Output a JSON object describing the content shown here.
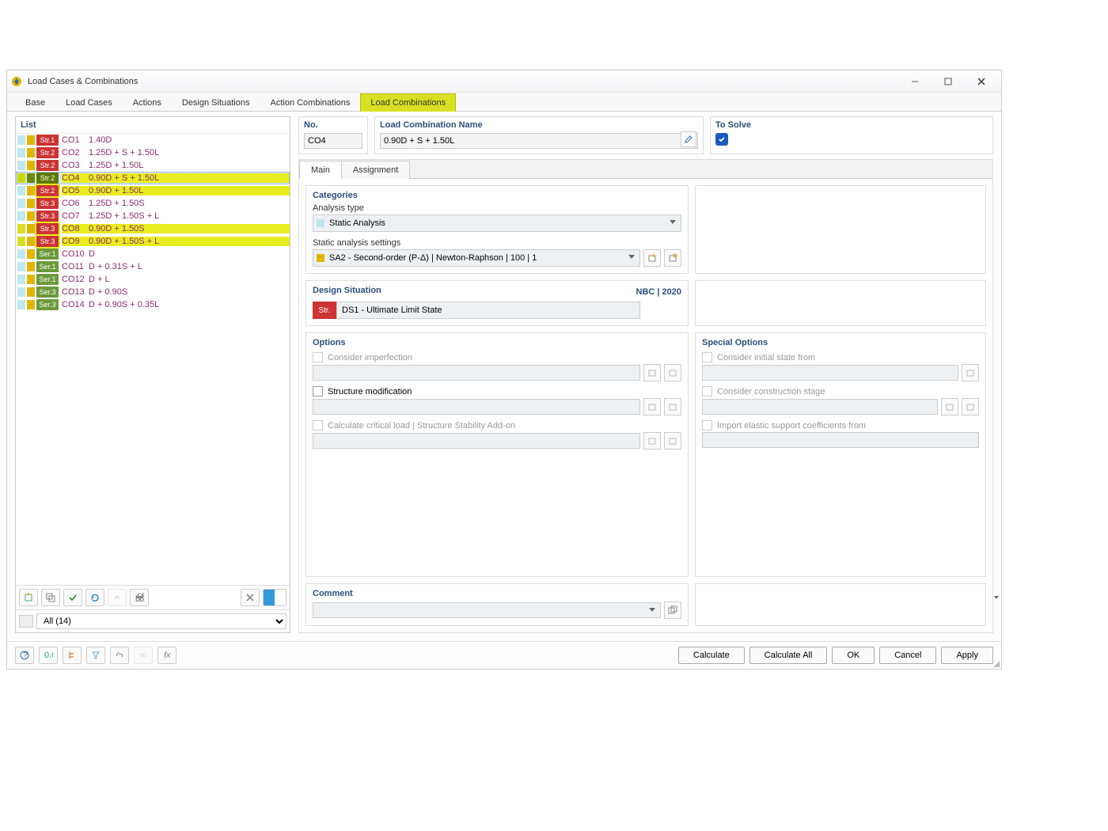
{
  "window": {
    "title": "Load Cases & Combinations"
  },
  "tabs": [
    "Base",
    "Load Cases",
    "Actions",
    "Design Situations",
    "Action Combinations",
    "Load Combinations"
  ],
  "activeTab": 5,
  "list": {
    "header": "List",
    "items": [
      {
        "sw1": "#bfe8f0",
        "sw2": "#e2b600",
        "badge": "Str.1",
        "badgeBg": "#c33",
        "co": "CO1",
        "desc": "1.40D",
        "selected": false,
        "hl": false
      },
      {
        "sw1": "#bfe8f0",
        "sw2": "#e2b600",
        "badge": "Str.2",
        "badgeBg": "#c33",
        "co": "CO2",
        "desc": "1.25D + S + 1.50L",
        "selected": false,
        "hl": false
      },
      {
        "sw1": "#bfe8f0",
        "sw2": "#e2b600",
        "badge": "Str.2",
        "badgeBg": "#c33",
        "co": "CO3",
        "desc": "1.25D + 1.50L",
        "selected": false,
        "hl": false
      },
      {
        "sw1": "#c7d900",
        "sw2": "#6a8a00",
        "badge": "Str.2",
        "badgeBg": "#5d7a00",
        "co": "CO4",
        "desc": "0.90D + S + 1.50L",
        "selected": true,
        "hl": true
      },
      {
        "sw1": "#bfe8f0",
        "sw2": "#e2b600",
        "badge": "Str.2",
        "badgeBg": "#c33",
        "co": "CO5",
        "desc": "0.90D + 1.50L",
        "selected": false,
        "hl": true
      },
      {
        "sw1": "#bfe8f0",
        "sw2": "#e2b600",
        "badge": "Str.3",
        "badgeBg": "#c33",
        "co": "CO6",
        "desc": "1.25D + 1.50S",
        "selected": false,
        "hl": false
      },
      {
        "sw1": "#bfe8f0",
        "sw2": "#e2b600",
        "badge": "Str.3",
        "badgeBg": "#c33",
        "co": "CO7",
        "desc": "1.25D + 1.50S + L",
        "selected": false,
        "hl": false
      },
      {
        "sw1": "#d9e021",
        "sw2": "#e2b600",
        "badge": "Str.3",
        "badgeBg": "#c33",
        "co": "CO8",
        "desc": "0.90D + 1.50S",
        "selected": false,
        "hl": true
      },
      {
        "sw1": "#d9e021",
        "sw2": "#e2b600",
        "badge": "Str.3",
        "badgeBg": "#c33",
        "co": "CO9",
        "desc": "0.90D + 1.50S + L",
        "selected": false,
        "hl": true
      },
      {
        "sw1": "#bfe8f0",
        "sw2": "#e2b600",
        "badge": "Ser.1",
        "badgeBg": "#6a9a3a",
        "co": "CO10",
        "desc": "D",
        "selected": false,
        "hl": false
      },
      {
        "sw1": "#bfe8f0",
        "sw2": "#e2b600",
        "badge": "Ser.1",
        "badgeBg": "#6a9a3a",
        "co": "CO11",
        "desc": "D + 0.31S + L",
        "selected": false,
        "hl": false
      },
      {
        "sw1": "#bfe8f0",
        "sw2": "#e2b600",
        "badge": "Ser.1",
        "badgeBg": "#6a9a3a",
        "co": "CO12",
        "desc": "D + L",
        "selected": false,
        "hl": false
      },
      {
        "sw1": "#bfe8f0",
        "sw2": "#e2b600",
        "badge": "Ser.3",
        "badgeBg": "#6a9a3a",
        "co": "CO13",
        "desc": "D + 0.90S",
        "selected": false,
        "hl": false
      },
      {
        "sw1": "#bfe8f0",
        "sw2": "#e2b600",
        "badge": "Ser.3",
        "badgeBg": "#6a9a3a",
        "co": "CO14",
        "desc": "D + 0.90S + 0.35L",
        "selected": false,
        "hl": false
      }
    ],
    "filter": "All (14)"
  },
  "detail": {
    "noLabel": "No.",
    "no": "CO4",
    "nameLabel": "Load Combination Name",
    "name": "0.90D + S + 1.50L",
    "toSolveLabel": "To Solve",
    "toSolve": true,
    "subtabs": [
      "Main",
      "Assignment"
    ],
    "activeSubtab": 0,
    "categories": {
      "header": "Categories",
      "analysisTypeLabel": "Analysis type",
      "analysisType": "Static Analysis",
      "analysisTypeSw": "#bfe8f0",
      "settingsLabel": "Static analysis settings",
      "settings": "SA2 - Second-order (P-Δ) | Newton-Raphson | 100 | 1",
      "settingsSw": "#e2b600"
    },
    "designSituation": {
      "header": "Design Situation",
      "code": "NBC | 2020",
      "badge": "Str.",
      "text": "DS1 - Ultimate Limit State"
    },
    "options": {
      "header": "Options",
      "imperfection": "Consider imperfection",
      "structureMod": "Structure modification",
      "criticalLoad": "Calculate critical load | Structure Stability Add-on"
    },
    "specialOptions": {
      "header": "Special Options",
      "initialState": "Consider initial state from",
      "constructionStage": "Consider construction stage",
      "elasticSupport": "Import elastic support coefficients from"
    },
    "commentHeader": "Comment"
  },
  "buttons": {
    "calculate": "Calculate",
    "calculateAll": "Calculate All",
    "ok": "OK",
    "cancel": "Cancel",
    "apply": "Apply"
  }
}
